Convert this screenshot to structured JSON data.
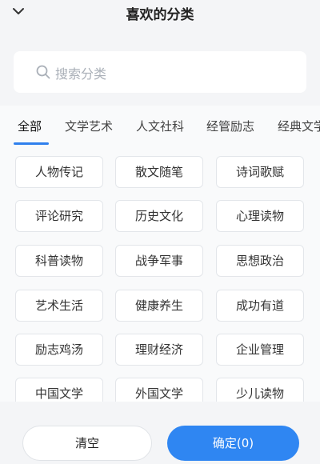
{
  "header": {
    "title": "喜欢的分类",
    "collapse_icon": "chevron-down-icon"
  },
  "search": {
    "placeholder": "搜索分类",
    "icon": "search-icon"
  },
  "tabs": [
    {
      "label": "全部",
      "active": true
    },
    {
      "label": "文学艺术",
      "active": false
    },
    {
      "label": "人文社科",
      "active": false
    },
    {
      "label": "经管励志",
      "active": false
    },
    {
      "label": "经典文学",
      "active": false
    }
  ],
  "categories": [
    "人物传记",
    "散文随笔",
    "诗词歌赋",
    "评论研究",
    "历史文化",
    "心理读物",
    "科普读物",
    "战争军事",
    "思想政治",
    "艺术生活",
    "健康养生",
    "成功有道",
    "励志鸡汤",
    "理财经济",
    "企业管理",
    "中国文学",
    "外国文学",
    "少儿读物"
  ],
  "footer": {
    "clear_label": "清空",
    "confirm_label": "确定(0)"
  },
  "colors": {
    "accent": "#2f86f2",
    "background": "#f4f5f7",
    "chip_border": "#e3e6ea"
  }
}
